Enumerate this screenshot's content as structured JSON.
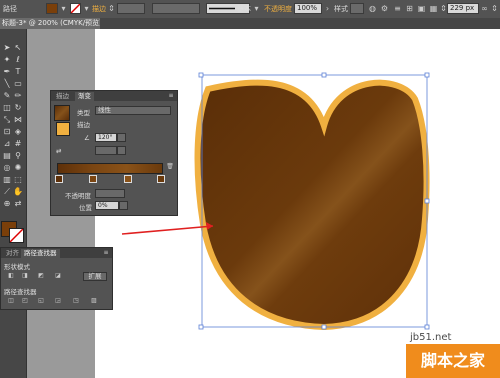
{
  "control_bar": {
    "path_label": "路径",
    "stroke_label": "描边",
    "brush_label": "基本",
    "opacity_label": "不透明度",
    "opacity_value": "100%",
    "style_label": "样式",
    "width_value": "229 px",
    "fill_color": "#7a3f0a"
  },
  "document": {
    "tab_title": "标题-3* @ 200% (CMYK/预览)"
  },
  "gradient_panel": {
    "tabs": [
      "描边",
      "渐变"
    ],
    "type_label": "类型",
    "type_value": "线性",
    "stroke_label": "描边",
    "angle_value": "120°",
    "opacity_label": "不透明度",
    "location_label": "位置",
    "location_value": "0%",
    "stop_colors": [
      "#5e3009",
      "#7a4512",
      "#8a5218",
      "#6a3a0c"
    ]
  },
  "pathfinder_panel": {
    "tabs": [
      "对齐",
      "路径查找器"
    ],
    "shape_modes_label": "形状模式",
    "expand_label": "扩展",
    "pathfinder_label": "路径查找器"
  },
  "shape": {
    "fill_dark": "#5a2e08",
    "fill_light": "#85521b",
    "stroke_color": "#f0b040"
  },
  "watermark": {
    "site": "jb51.net",
    "brand": "脚本之家"
  }
}
